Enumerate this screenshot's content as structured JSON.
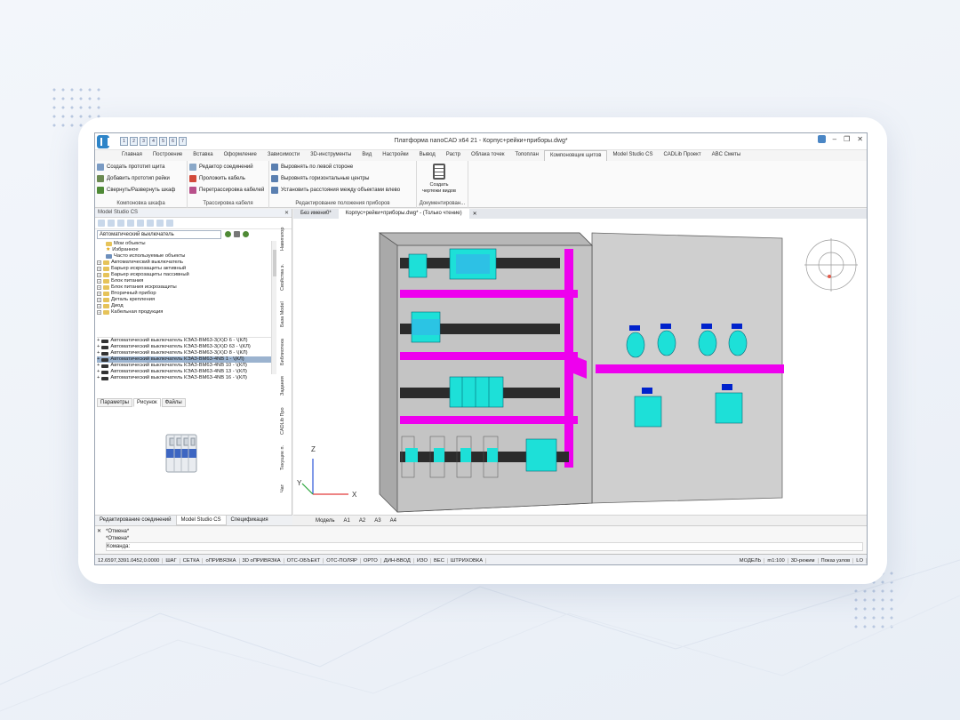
{
  "window": {
    "title": "Платформа nanoCAD x64 21 - Корпус+рейки+приборы.dwg*",
    "qat_buttons": [
      "1",
      "2",
      "3",
      "4",
      "5",
      "6",
      "7"
    ]
  },
  "ribbon_tabs": [
    {
      "label": "Главная"
    },
    {
      "label": "Построение"
    },
    {
      "label": "Вставка"
    },
    {
      "label": "Оформление"
    },
    {
      "label": "Зависимости"
    },
    {
      "label": "3D-инструменты"
    },
    {
      "label": "Вид"
    },
    {
      "label": "Настройки"
    },
    {
      "label": "Вывод"
    },
    {
      "label": "Растр"
    },
    {
      "label": "Облака точек"
    },
    {
      "label": "Топоплан"
    },
    {
      "label": "Компоновщик щитов",
      "active": true
    },
    {
      "label": "Model Studio CS"
    },
    {
      "label": "CADLib Проект"
    },
    {
      "label": "ABC Сметы"
    }
  ],
  "ribbon": {
    "group1": {
      "label": "Компоновка шкафа",
      "items": [
        "Создать прототип щита",
        "Добавить прототип рейки",
        "Свернуть/Развернуть шкаф"
      ]
    },
    "group2": {
      "label": "Трассировка кабеля",
      "items": [
        "Редактор соединений",
        "Проложить кабель",
        "Перетрассировка кабелей"
      ]
    },
    "group3": {
      "label": "Редактирование положения приборов",
      "items": [
        "Выровнять по левой стороне",
        "Выровнять горизонтальные центры",
        "Установить расстояния между объектами влево"
      ]
    },
    "group4": {
      "label": "Документирован...",
      "button": "Создать чертежи видов"
    }
  },
  "left_panel": {
    "title": "Model Studio CS",
    "combo_value": "Автоматический выключатель",
    "tree": [
      "Мои объекты",
      "Избранное",
      "Часто используемые объекты",
      "Автоматический выключатель",
      "Барьер искрозащиты активный",
      "Барьер искрозащиты пассивный",
      "Блок питания",
      "Блок питания искрозащиты",
      "Вторичный прибор",
      "Деталь крепления",
      "Диод",
      "Кабельная продукция"
    ],
    "components": [
      "Автоматический выключатель КЭАЗ-ВМ63-3(X)D 6 - \\(КЛ)",
      "Автоматический выключатель КЭАЗ-ВМ63-3(X)D 63 - \\(КЛ)",
      "Автоматический выключатель КЭАЗ-ВМ63-3(X)D 8 - \\(КЛ)",
      "Автоматический выключатель КЭАЗ-ВМ63-4NB 1 - \\(КЛ)",
      "Автоматический выключатель КЭАЗ-ВМ63-4NB 10 - \\(КЛ)",
      "Автоматический выключатель КЭАЗ-ВМ63-4NB 13 - \\(КЛ)",
      "Автоматический выключатель КЭАЗ-ВМ63-4NB 16 - \\(КЛ)"
    ],
    "selected_index": 3,
    "subtabs": [
      "Параметры",
      "Рисунок",
      "Файлы"
    ],
    "side_tabs": [
      "Навигатор",
      "Свойства э.",
      "База Model",
      "Библиотека",
      "Задания",
      "CADLib Про",
      "Текущие п.",
      "Чат"
    ],
    "bottom_tabs": [
      "Редактирование соединений",
      "Model Studio CS",
      "Спецификация"
    ]
  },
  "doc_tabs": [
    "Без имени0*",
    "Корпус+рейки+приборы.dwg* - (Только чтение)"
  ],
  "layout_tabs": [
    "Модель",
    "A1",
    "A2",
    "A3",
    "A4"
  ],
  "axes": {
    "x": "X",
    "y": "Y",
    "z": "Z"
  },
  "command_lines": [
    "*Отмена*",
    "*Отмена*",
    "Команда:"
  ],
  "status": {
    "coords": "12.6597,3391.0452,0.0000",
    "toggles": [
      "ШАГ",
      "СЕТКА",
      "оПРИВЯЗКА",
      "3D оПРИВЯЗКА",
      "ОТС-ОБЪЕКТ",
      "ОТС-ПОЛЯР",
      "ОРТО",
      "ДИН-ВВОД",
      "ИЗО",
      "ВЕС",
      "ШТРИХОВКА"
    ],
    "model": "МОДЕЛЬ",
    "scale": "m1:100",
    "mode": "3D-режим",
    "nodes": "Показ узлов",
    "tail": "LO"
  },
  "colors": {
    "accent": "#2d84c8",
    "rail": "#ee00ee",
    "device": "#1de0d8",
    "cabinet": "#c6c6c6"
  }
}
